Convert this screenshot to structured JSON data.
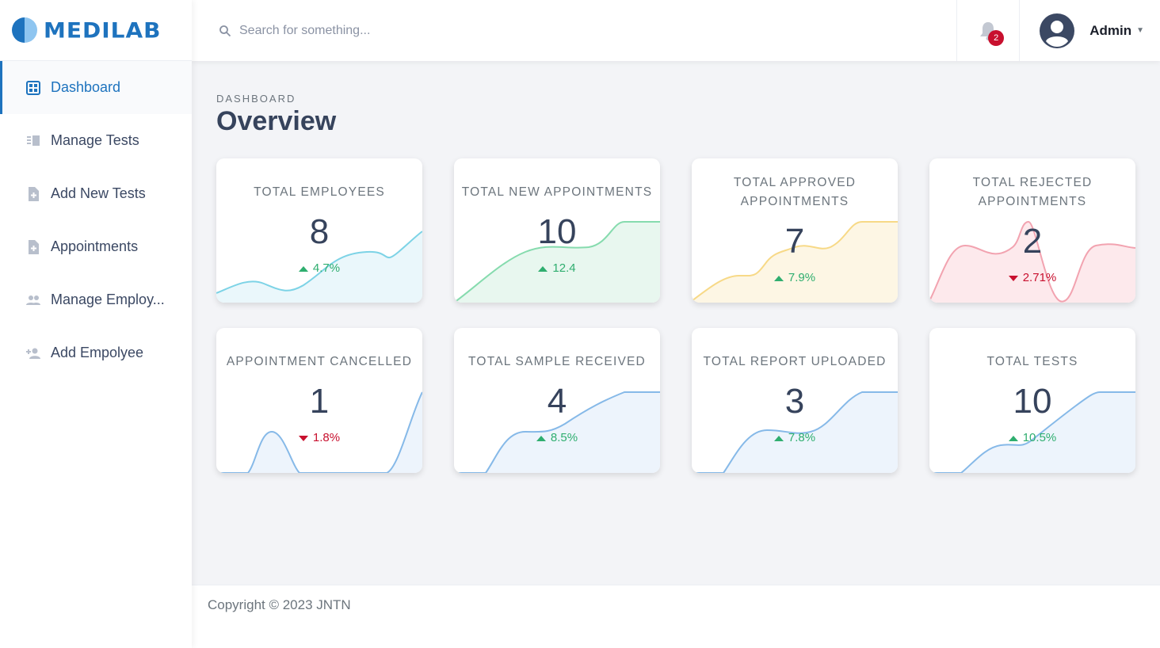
{
  "brand": {
    "name": "MEDILAB"
  },
  "sidebar": {
    "items": [
      {
        "label": "Dashboard",
        "icon": "dashboard-icon",
        "active": true
      },
      {
        "label": "Manage Tests",
        "icon": "list-icon"
      },
      {
        "label": "Add New Tests",
        "icon": "file-plus-icon"
      },
      {
        "label": "Appointments",
        "icon": "file-plus-icon"
      },
      {
        "label": "Manage Employ...",
        "icon": "users-icon"
      },
      {
        "label": "Add Empolyee",
        "icon": "user-plus-icon"
      }
    ]
  },
  "topbar": {
    "search_placeholder": "Search for something...",
    "notification_count": "2",
    "user_name": "Admin"
  },
  "page": {
    "breadcrumb": "DASHBOARD",
    "title": "Overview"
  },
  "colors": {
    "accent": "#1e73be",
    "up": "#2fae6f",
    "down": "#c8102e"
  },
  "cards": [
    {
      "title": "TOTAL EMPLOYEES",
      "value": "8",
      "delta": "4.7%",
      "trend": "up",
      "color": "#7dd3e6",
      "fill": "#eaf7fb"
    },
    {
      "title": "TOTAL NEW APPOINTMENTS",
      "value": "10",
      "delta": "12.4",
      "trend": "up",
      "color": "#86dbae",
      "fill": "#e8f7ef"
    },
    {
      "title": "TOTAL APPROVED APPOINTMENTS",
      "value": "7",
      "delta": "7.9%",
      "trend": "up",
      "color": "#f7d987",
      "fill": "#fdf6e4"
    },
    {
      "title": "TOTAL REJECTED APPOINTMENTS",
      "value": "2",
      "delta": "2.71%",
      "trend": "down",
      "color": "#f2a3b0",
      "fill": "#fde9ec"
    },
    {
      "title": "APPOINTMENT CANCELLED",
      "value": "1",
      "delta": "1.8%",
      "trend": "down",
      "color": "#86b9e8",
      "fill": "#edf4fc"
    },
    {
      "title": "TOTAL SAMPLE RECEIVED",
      "value": "4",
      "delta": "8.5%",
      "trend": "up",
      "color": "#86b9e8",
      "fill": "#edf4fc"
    },
    {
      "title": "TOTAL REPORT UPLOADED",
      "value": "3",
      "delta": "7.8%",
      "trend": "up",
      "color": "#86b9e8",
      "fill": "#edf4fc"
    },
    {
      "title": "TOTAL TESTS",
      "value": "10",
      "delta": "10.5%",
      "trend": "up",
      "color": "#86b9e8",
      "fill": "#edf4fc"
    }
  ],
  "footer": {
    "copyright": "Copyright © 2023 JNTN"
  }
}
